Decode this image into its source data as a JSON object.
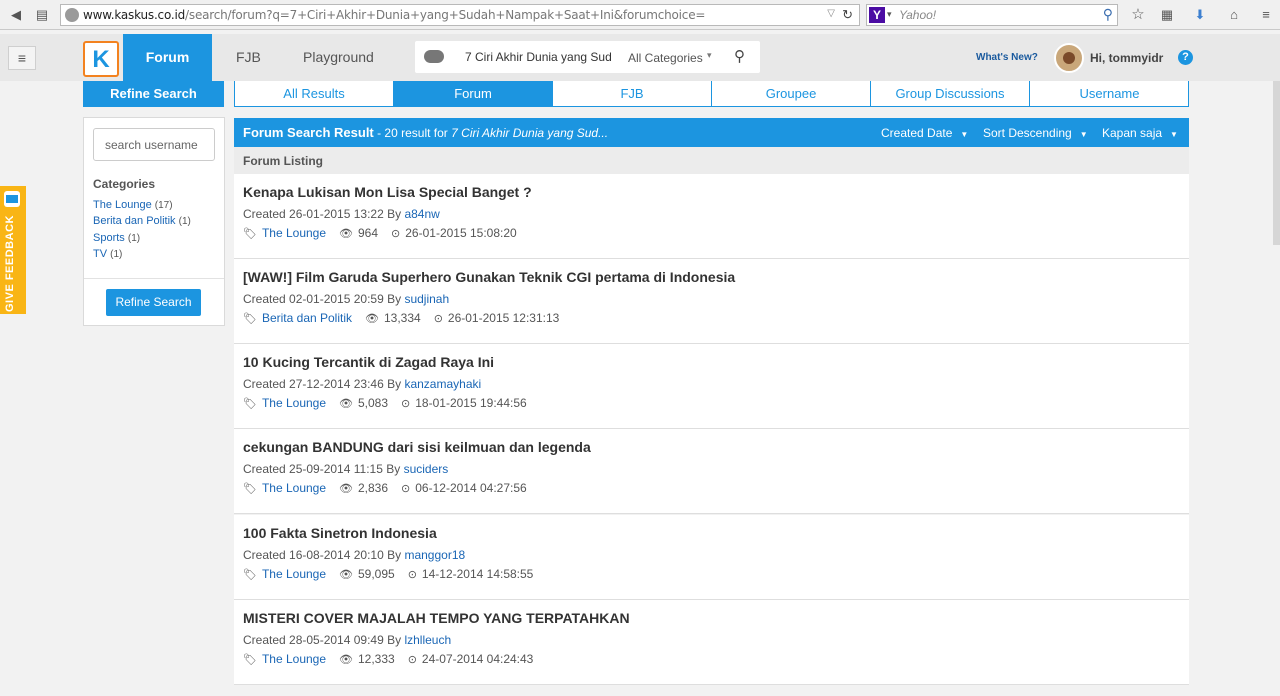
{
  "browser": {
    "url_domain": "www.kaskus.co.id",
    "url_path": "/search/forum?q=7+Ciri+Akhir+Dunia+yang+Sudah+Nampak+Saat+Ini&forumchoice=",
    "search_engine": "Y",
    "search_placeholder": "Yahoo!"
  },
  "header": {
    "logo": "K",
    "nav": {
      "forum": "Forum",
      "fjb": "FJB",
      "playground": "Playground"
    },
    "search_query": "7 Ciri Akhir Dunia yang Sud",
    "category": "All Categories",
    "whats_new": "What's New?",
    "greeting": "Hi, tommyidr",
    "help": "?"
  },
  "feedback": {
    "label": "GIVE FEEDBACK"
  },
  "sidebar": {
    "title": "Refine Search",
    "username_placeholder": "search username",
    "categories_title": "Categories",
    "categories": [
      {
        "name": "The Lounge",
        "count": "(17)"
      },
      {
        "name": "Berita dan Politik",
        "count": "(1)"
      },
      {
        "name": "Sports",
        "count": "(1)"
      },
      {
        "name": "TV",
        "count": "(1)"
      }
    ],
    "button": "Refine Search"
  },
  "tabs": [
    "All Results",
    "Forum",
    "FJB",
    "Groupee",
    "Group Discussions",
    "Username"
  ],
  "active_tab": "Forum",
  "results": {
    "title": "Forum Search Result",
    "count": " - 20 result for ",
    "query": "7 Ciri Akhir Dunia yang Sud...",
    "sort_field": "Created Date",
    "sort_order": "Sort Descending",
    "time_filter": "Kapan saja",
    "listing": "Forum Listing"
  },
  "threads": [
    {
      "title": "Kenapa Lukisan Mon Lisa Special Banget ?",
      "created": "Created 26-01-2015 13:22 By ",
      "author": "a84nw",
      "category": "The Lounge",
      "views": "964",
      "last": "26-01-2015 15:08:20"
    },
    {
      "title": "[WAW!] Film Garuda Superhero Gunakan Teknik CGI pertama di Indonesia",
      "created": "Created 02-01-2015 20:59 By ",
      "author": "sudjinah",
      "category": "Berita dan Politik",
      "views": "13,334",
      "last": "26-01-2015 12:31:13"
    },
    {
      "title": "10 Kucing Tercantik di Zagad Raya Ini",
      "created": "Created 27-12-2014 23:46 By ",
      "author": "kanzamayhaki",
      "category": "The Lounge",
      "views": "5,083",
      "last": "18-01-2015 19:44:56"
    },
    {
      "title": "cekungan BANDUNG dari sisi keilmuan dan legenda",
      "created": "Created 25-09-2014 11:15 By ",
      "author": "suciders",
      "category": "The Lounge",
      "views": "2,836",
      "last": "06-12-2014 04:27:56"
    },
    {
      "title": "100 Fakta Sinetron Indonesia",
      "created": "Created 16-08-2014 20:10 By ",
      "author": "manggor18",
      "category": "The Lounge",
      "views": "59,095",
      "last": "14-12-2014 14:58:55"
    },
    {
      "title": "MISTERI COVER MAJALAH TEMPO YANG TERPATAHKAN",
      "created": "Created 28-05-2014 09:49 By ",
      "author": "lzhlleuch",
      "category": "The Lounge",
      "views": "12,333",
      "last": "24-07-2014 04:24:43"
    }
  ],
  "colors": {
    "accent": "#1c95e0",
    "brand_orange": "#f3821f",
    "feedback": "#f9b515",
    "link": "#1a66b5"
  }
}
